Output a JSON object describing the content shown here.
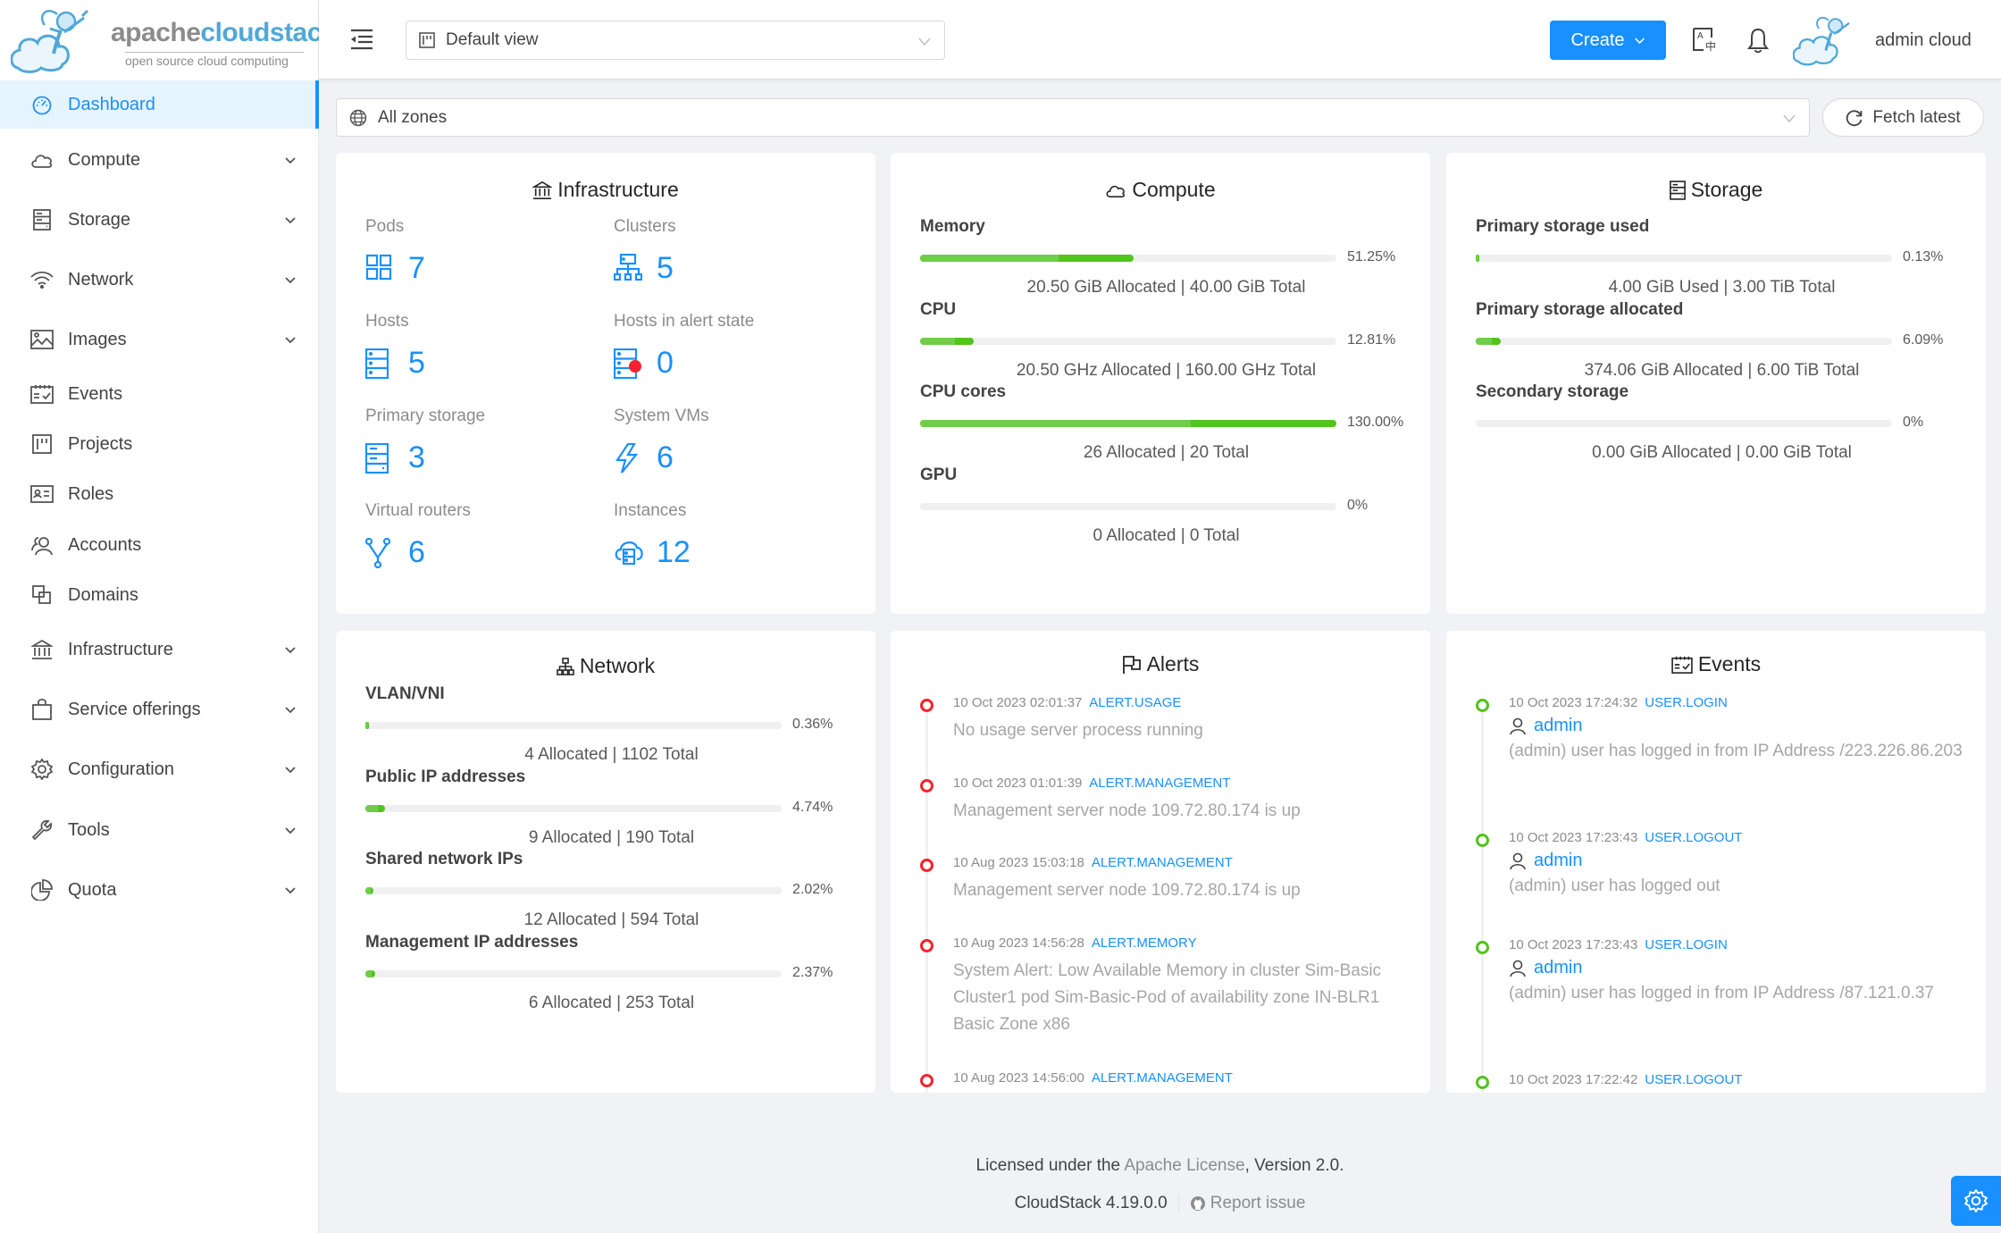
{
  "brand": {
    "word_a": "apache",
    "word_b": "cloudstack",
    "tm": "™",
    "tagline": "open source cloud computing"
  },
  "sidebar": {
    "items": [
      {
        "label": "Dashboard",
        "icon": "dashboard-icon",
        "active": true,
        "expandable": false
      },
      {
        "label": "Compute",
        "icon": "cloud-icon",
        "expandable": true
      },
      {
        "label": "Storage",
        "icon": "database-icon",
        "expandable": true
      },
      {
        "label": "Network",
        "icon": "wifi-icon",
        "expandable": true
      },
      {
        "label": "Images",
        "icon": "picture-icon",
        "expandable": true
      },
      {
        "label": "Events",
        "icon": "schedule-icon",
        "expandable": false
      },
      {
        "label": "Projects",
        "icon": "project-icon",
        "expandable": false
      },
      {
        "label": "Roles",
        "icon": "idcard-icon",
        "expandable": false
      },
      {
        "label": "Accounts",
        "icon": "team-icon",
        "expandable": false
      },
      {
        "label": "Domains",
        "icon": "block-icon",
        "expandable": false
      },
      {
        "label": "Infrastructure",
        "icon": "bank-icon",
        "expandable": true
      },
      {
        "label": "Service offerings",
        "icon": "shopping-icon",
        "expandable": true
      },
      {
        "label": "Configuration",
        "icon": "setting-icon",
        "expandable": true
      },
      {
        "label": "Tools",
        "icon": "tool-icon",
        "expandable": true
      },
      {
        "label": "Quota",
        "icon": "pie-chart-icon",
        "expandable": true
      }
    ]
  },
  "header": {
    "view_select": "Default view",
    "create_label": "Create",
    "user_name": "admin cloud"
  },
  "toolbar": {
    "zone_select": "All zones",
    "fetch_label": "Fetch latest"
  },
  "infrastructure": {
    "title": "Infrastructure",
    "cells": [
      {
        "label": "Pods",
        "value": "7",
        "icon": "appstore-icon"
      },
      {
        "label": "Clusters",
        "value": "5",
        "icon": "cluster-icon"
      },
      {
        "label": "Hosts",
        "value": "5",
        "icon": "host-icon"
      },
      {
        "label": "Hosts in alert state",
        "value": "0",
        "icon": "host-alert-icon"
      },
      {
        "label": "Primary storage",
        "value": "3",
        "icon": "storage-icon"
      },
      {
        "label": "System VMs",
        "value": "6",
        "icon": "thunderbolt-icon"
      },
      {
        "label": "Virtual routers",
        "value": "6",
        "icon": "fork-icon"
      },
      {
        "label": "Instances",
        "value": "12",
        "icon": "cloud-server-icon"
      }
    ]
  },
  "compute": {
    "title": "Compute",
    "metrics": [
      {
        "label": "Memory",
        "percent": 51.25,
        "pct_text": "51.25%",
        "detail": "20.50 GiB Allocated | 40.00 GiB Total"
      },
      {
        "label": "CPU",
        "percent": 12.81,
        "pct_text": "12.81%",
        "detail": "20.50 GHz Allocated | 160.00 GHz Total"
      },
      {
        "label": "CPU cores",
        "percent": 130.0,
        "pct_text": "130.00%",
        "detail": "26 Allocated | 20 Total"
      },
      {
        "label": "GPU",
        "percent": 0,
        "pct_text": "0%",
        "detail": "0 Allocated | 0 Total"
      }
    ]
  },
  "storage": {
    "title": "Storage",
    "metrics": [
      {
        "label": "Primary storage used",
        "percent": 0.13,
        "pct_text": "0.13%",
        "detail": "4.00 GiB Used | 3.00 TiB Total"
      },
      {
        "label": "Primary storage allocated",
        "percent": 6.09,
        "pct_text": "6.09%",
        "detail": "374.06 GiB Allocated | 6.00 TiB Total"
      },
      {
        "label": "Secondary storage",
        "percent": 0,
        "pct_text": "0%",
        "detail": "0.00 GiB Allocated | 0.00 GiB Total"
      }
    ]
  },
  "network": {
    "title": "Network",
    "metrics": [
      {
        "label": "VLAN/VNI",
        "percent": 0.36,
        "pct_text": "0.36%",
        "detail": "4 Allocated | 1102 Total"
      },
      {
        "label": "Public IP addresses",
        "percent": 4.74,
        "pct_text": "4.74%",
        "detail": "9 Allocated | 190 Total"
      },
      {
        "label": "Shared network IPs",
        "percent": 2.02,
        "pct_text": "2.02%",
        "detail": "12 Allocated | 594 Total"
      },
      {
        "label": "Management IP addresses",
        "percent": 2.37,
        "pct_text": "2.37%",
        "detail": "6 Allocated | 253 Total"
      }
    ]
  },
  "alerts": {
    "title": "Alerts",
    "items": [
      {
        "time": "10 Oct 2023 02:01:37",
        "type": "ALERT.USAGE",
        "text": "No usage server process running"
      },
      {
        "time": "10 Oct 2023 01:01:39",
        "type": "ALERT.MANAGEMENT",
        "text": "Management server node 109.72.80.174 is up"
      },
      {
        "time": "10 Aug 2023 15:03:18",
        "type": "ALERT.MANAGEMENT",
        "text": "Management server node 109.72.80.174 is up"
      },
      {
        "time": "10 Aug 2023 14:56:28",
        "type": "ALERT.MEMORY",
        "text": "System Alert: Low Available Memory in cluster Sim-Basic Cluster1 pod Sim-Basic-Pod of availability zone IN-BLR1 Basic Zone x86"
      },
      {
        "time": "10 Aug 2023 14:56:00",
        "type": "ALERT.MANAGEMENT",
        "text": ""
      }
    ]
  },
  "events": {
    "title": "Events",
    "items": [
      {
        "time": "10 Oct 2023 17:24:32",
        "type": "USER.LOGIN",
        "user": "admin",
        "text": "(admin) user has logged in from IP Address /223.226.86.203"
      },
      {
        "time": "10 Oct 2023 17:23:43",
        "type": "USER.LOGOUT",
        "user": "admin",
        "text": "(admin) user has logged out"
      },
      {
        "time": "10 Oct 2023 17:23:43",
        "type": "USER.LOGIN",
        "user": "admin",
        "text": "(admin) user has logged in from IP Address /87.121.0.37"
      },
      {
        "time": "10 Oct 2023 17:22:42",
        "type": "USER.LOGOUT",
        "user": "",
        "text": ""
      }
    ]
  },
  "footer": {
    "license_prefix": "Licensed under the ",
    "license_link": "Apache License",
    "license_suffix": ", Version 2.0.",
    "version": "CloudStack 4.19.0.0",
    "report_issue": "Report issue"
  },
  "colors": {
    "accent": "#1890ff",
    "success": "#52c41a",
    "alert_dot": "#f5222d",
    "event_dot": "#52c41a",
    "background": "#f0f2f5"
  }
}
